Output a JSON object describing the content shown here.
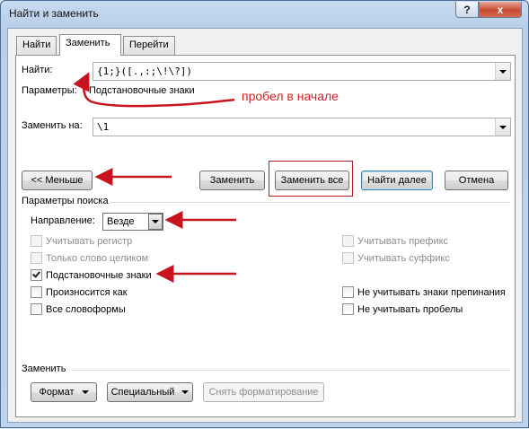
{
  "window": {
    "title": "Найти и заменить",
    "help_glyph": "?",
    "close_glyph": "x"
  },
  "tabs": [
    {
      "label": "Найти"
    },
    {
      "label": "Заменить"
    },
    {
      "label": "Перейти"
    }
  ],
  "find": {
    "label": "Найти:",
    "value": "{1;}([.,:;\\!\\?])"
  },
  "options_line": {
    "label": "Параметры:",
    "value": "Подстановочные знаки"
  },
  "replace": {
    "label": "Заменить на:",
    "value": "\\1"
  },
  "buttons": {
    "less": "<< Меньше",
    "replace": "Заменить",
    "replace_all": "Заменить все",
    "find_next": "Найти далее",
    "cancel": "Отмена"
  },
  "search_options": {
    "heading": "Параметры поиска",
    "direction_label": "Направление:",
    "direction_value": "Везде",
    "left": [
      {
        "label": "Учитывать регистр",
        "checked": false,
        "disabled": true
      },
      {
        "label": "Только слово целиком",
        "checked": false,
        "disabled": true
      },
      {
        "label": "Подстановочные знаки",
        "checked": true,
        "disabled": false
      },
      {
        "label": "Произносится как",
        "checked": false,
        "disabled": false
      },
      {
        "label": "Все словоформы",
        "checked": false,
        "disabled": false
      }
    ],
    "right": [
      {
        "label": "Учитывать префикс",
        "checked": false,
        "disabled": true
      },
      {
        "label": "Учитывать суффикс",
        "checked": false,
        "disabled": true
      },
      {
        "label": "Не учитывать знаки препинания",
        "checked": false,
        "disabled": false
      },
      {
        "label": "Не учитывать пробелы",
        "checked": false,
        "disabled": false
      }
    ]
  },
  "replace_section": {
    "heading": "Заменить",
    "format": "Формат",
    "special": "Специальный",
    "clear_formatting": "Снять форматирование"
  },
  "annotation": {
    "text": "пробел в начале"
  },
  "colors": {
    "annotation_red": "#c8141e"
  }
}
